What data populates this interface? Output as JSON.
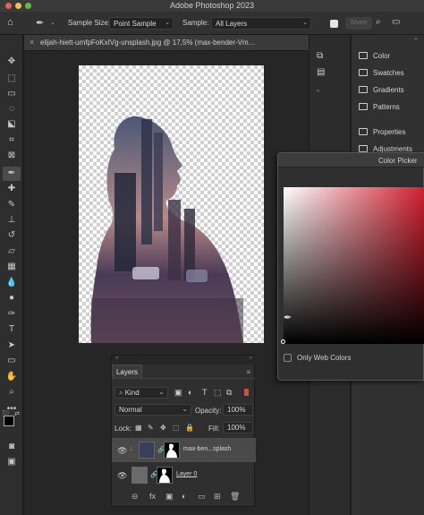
{
  "window": {
    "title": "Adobe Photoshop 2023"
  },
  "options_bar": {
    "sample_size_label": "Sample Size:",
    "sample_size_value": "Point Sample",
    "sample_label": "Sample:",
    "sample_value": "All Layers",
    "share_label": "Share"
  },
  "document": {
    "tab_title": "elijah-hiett-umfpFoKxIVg-unsplash.jpg @ 17,5% (max-bender-Vm..."
  },
  "panels": {
    "items": [
      {
        "label": "Color"
      },
      {
        "label": "Swatches"
      },
      {
        "label": "Gradients"
      },
      {
        "label": "Patterns"
      },
      {
        "label": "Properties"
      },
      {
        "label": "Adjustments"
      }
    ]
  },
  "color_picker": {
    "title": "Color Picker",
    "only_web_colors_label": "Only Web Colors",
    "accent_hue": "#d21f2f"
  },
  "layers_panel": {
    "tab_label": "Layers",
    "filter_value": "Kind",
    "blend_mode": "Normal",
    "opacity_label": "Opacity:",
    "opacity_value": "100%",
    "lock_label": "Lock:",
    "fill_label": "Fill:",
    "fill_value": "100%",
    "layers": [
      {
        "name": "max-ben...splash"
      },
      {
        "name": "Layer 0"
      }
    ]
  }
}
